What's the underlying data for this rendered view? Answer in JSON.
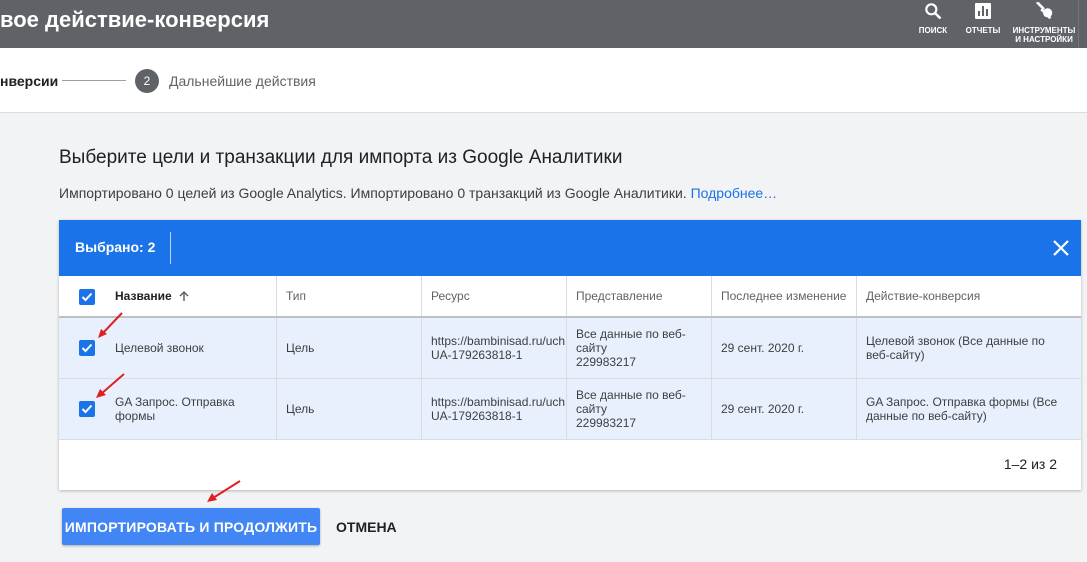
{
  "header": {
    "title": "вое действие-конверсия",
    "search_label": "ПОИСК",
    "reports_label": "ОТЧЕТЫ",
    "tools_label_line1": "ИНСТРУМЕНТЫ",
    "tools_label_line2": "И НАСТРОЙКИ"
  },
  "stepper": {
    "step1_label": "нверсии",
    "step2_number": "2",
    "step2_label": "Дальнейшие действия"
  },
  "main": {
    "heading": "Выберите цели и транзакции для импорта из Google Аналитики",
    "description": "Импортировано 0 целей из Google Analytics. Импортировано 0 транзакций из Google Аналитики.",
    "learn_more": "Подробнее…"
  },
  "table": {
    "selected_label": "Выбрано: 2",
    "columns": [
      "Название",
      "Тип",
      "Ресурс",
      "Представление",
      "Последнее изменение",
      "Действие-конверсия"
    ],
    "rows": [
      {
        "name": "Целевой звонок",
        "type": "Цель",
        "resource_line1": "https://bambinisad.ru/uch",
        "resource_line2": "UA-179263818-1",
        "view_line1": "Все данные по веб-",
        "view_line2": "сайту",
        "view_line3": "229983217",
        "modified": "29 сент. 2020 г.",
        "conversion_action": "Целевой звонок (Все данные по веб-сайту)",
        "checked": true
      },
      {
        "name": "GA Запрос. Отправка формы",
        "type": "Цель",
        "resource_line1": "https://bambinisad.ru/uch",
        "resource_line2": "UA-179263818-1",
        "view_line1": "Все данные по веб-",
        "view_line2": "сайту",
        "view_line3": "229983217",
        "modified": "29 сент. 2020 г.",
        "conversion_action": "GA Запрос. Отправка формы (Все данные по веб-сайту)",
        "checked": true
      }
    ],
    "pagination": "1–2 из 2"
  },
  "actions": {
    "import_button": "ИМПОРТИРОВАТЬ И ПРОДОЛЖИТЬ",
    "cancel_button": "ОТМЕНА"
  },
  "colors": {
    "header_bg": "#5f6368",
    "accent": "#1a73e8",
    "button": "#4285f4",
    "selected_row": "#e8f0fe",
    "annotation_arrow": "#e02020"
  }
}
